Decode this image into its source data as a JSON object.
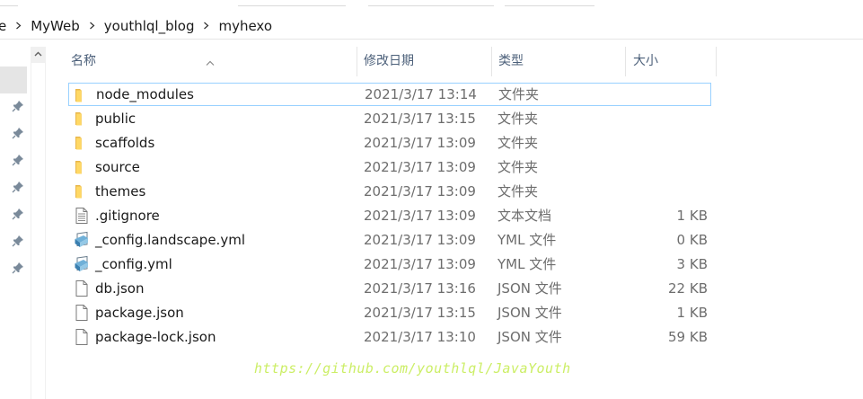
{
  "breadcrumb": {
    "partial_first": "e",
    "items": [
      "MyWeb",
      "youthlql_blog",
      "myhexo"
    ]
  },
  "columns": {
    "name": "名称",
    "date": "修改日期",
    "type": "类型",
    "size": "大小"
  },
  "files": [
    {
      "name": "node_modules",
      "date": "2021/3/17 13:14",
      "type": "文件夹",
      "size": "",
      "icon": "folder-icon",
      "selected": true
    },
    {
      "name": "public",
      "date": "2021/3/17 13:15",
      "type": "文件夹",
      "size": "",
      "icon": "folder-icon"
    },
    {
      "name": "scaffolds",
      "date": "2021/3/17 13:09",
      "type": "文件夹",
      "size": "",
      "icon": "folder-icon"
    },
    {
      "name": "source",
      "date": "2021/3/17 13:09",
      "type": "文件夹",
      "size": "",
      "icon": "folder-icon"
    },
    {
      "name": "themes",
      "date": "2021/3/17 13:09",
      "type": "文件夹",
      "size": "",
      "icon": "folder-icon"
    },
    {
      "name": ".gitignore",
      "date": "2021/3/17 13:09",
      "type": "文本文档",
      "size": "1 KB",
      "icon": "text-document-icon"
    },
    {
      "name": "_config.landscape.yml",
      "date": "2021/3/17 13:09",
      "type": "YML 文件",
      "size": "0 KB",
      "icon": "yml-file-icon"
    },
    {
      "name": "_config.yml",
      "date": "2021/3/17 13:09",
      "type": "YML 文件",
      "size": "3 KB",
      "icon": "yml-file-icon"
    },
    {
      "name": "db.json",
      "date": "2021/3/17 13:16",
      "type": "JSON 文件",
      "size": "22 KB",
      "icon": "blank-file-icon"
    },
    {
      "name": "package.json",
      "date": "2021/3/17 13:15",
      "type": "JSON 文件",
      "size": "1 KB",
      "icon": "blank-file-icon"
    },
    {
      "name": "package-lock.json",
      "date": "2021/3/17 13:10",
      "type": "JSON 文件",
      "size": "59 KB",
      "icon": "blank-file-icon"
    }
  ],
  "watermark": "https://github.com/youthlql/JavaYouth",
  "colors": {
    "folder": "#ffd865",
    "selection_border": "#99d1ff",
    "header_text": "#4c607a",
    "watermark": "#ccee66"
  }
}
